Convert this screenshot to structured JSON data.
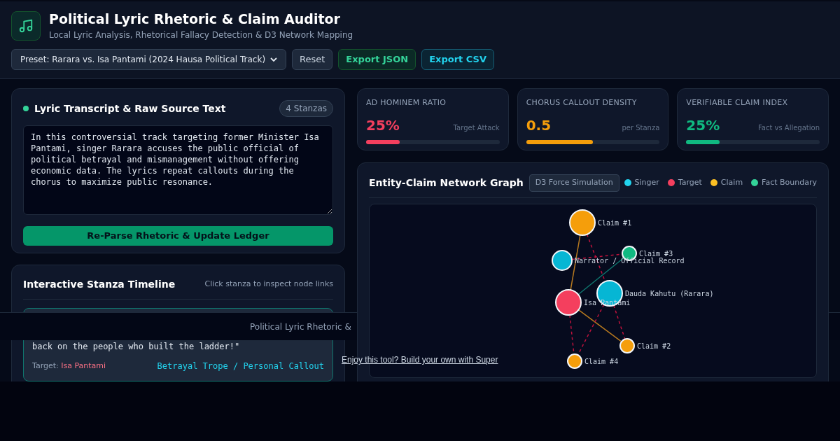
{
  "header": {
    "title": "Political Lyric Rhetoric & Claim Auditor",
    "subtitle": "Local Lyric Analysis, Rhetorical Fallacy Detection & D3 Network Mapping",
    "preset": "Preset: Rarara vs. Isa Pantami (2024 Hausa Political Track)",
    "buttons": [
      {
        "label": "Reset",
        "kind": "plain"
      },
      {
        "label": "Export JSON",
        "kind": "green"
      },
      {
        "label": "Export CSV",
        "kind": "cyan"
      }
    ]
  },
  "transcript": {
    "title": "Lyric Transcript & Raw Source Text",
    "badge": "4 Stanzas",
    "text": "In this controversial track targeting former Minister Isa Pantami, singer Rarara accuses the public official of political betrayal and mismanagement without offering economic data. The lyrics repeat callouts during the chorus to maximize public resonance.",
    "button": "Re-Parse Rhetoric & Update Ledger"
  },
  "timeline": {
    "title": "Interactive Stanza Timeline",
    "hint": "Click stanza to inspect node links",
    "stanzas": [
      {
        "selected": true,
        "lyric": "back on the people who built the ladder!\"",
        "target_label": "Target:",
        "target": "Isa Pantami",
        "trope": "Betrayal Trope / Personal Callout"
      }
    ]
  },
  "metrics": [
    {
      "label": "AD HOMINEM RATIO",
      "value": "25%",
      "unit": "Target Attack",
      "level": 0.25,
      "color": "#f43f5e"
    },
    {
      "label": "CHORUS CALLOUT DENSITY",
      "value": "0.5",
      "unit": "per Stanza",
      "level": 0.5,
      "color": "#f59e0b"
    },
    {
      "label": "VERIFIABLE CLAIM INDEX",
      "value": "25%",
      "unit": "Fact vs Allegation",
      "level": 0.25,
      "color": "#10b981"
    }
  ],
  "graph": {
    "title": "Entity-Claim Network Graph",
    "badge": "D3 Force Simulation",
    "legend": [
      {
        "label": "Singer",
        "color": "#22d3ee"
      },
      {
        "label": "Target",
        "color": "#f43f5e"
      },
      {
        "label": "Claim",
        "color": "#fbbf24"
      },
      {
        "label": "Fact Boundary",
        "color": "#34d399"
      }
    ],
    "nodes": [
      {
        "label": "Claim #1",
        "kind": "claim"
      },
      {
        "label": "Claim #3",
        "kind": "fact"
      },
      {
        "label": "Narrator / Official Record",
        "kind": "singer"
      },
      {
        "label": "Isa Pantami",
        "kind": "target"
      },
      {
        "label": "Dauda Kahutu (Rarara)",
        "kind": "singer"
      },
      {
        "label": "Claim #2",
        "kind": "claim"
      },
      {
        "label": "Claim #4",
        "kind": "claim"
      }
    ]
  },
  "banner": {
    "text": "Political Lyric Rhetoric &"
  },
  "promo": {
    "link": "Enjoy this tool? Build your own with Super"
  }
}
